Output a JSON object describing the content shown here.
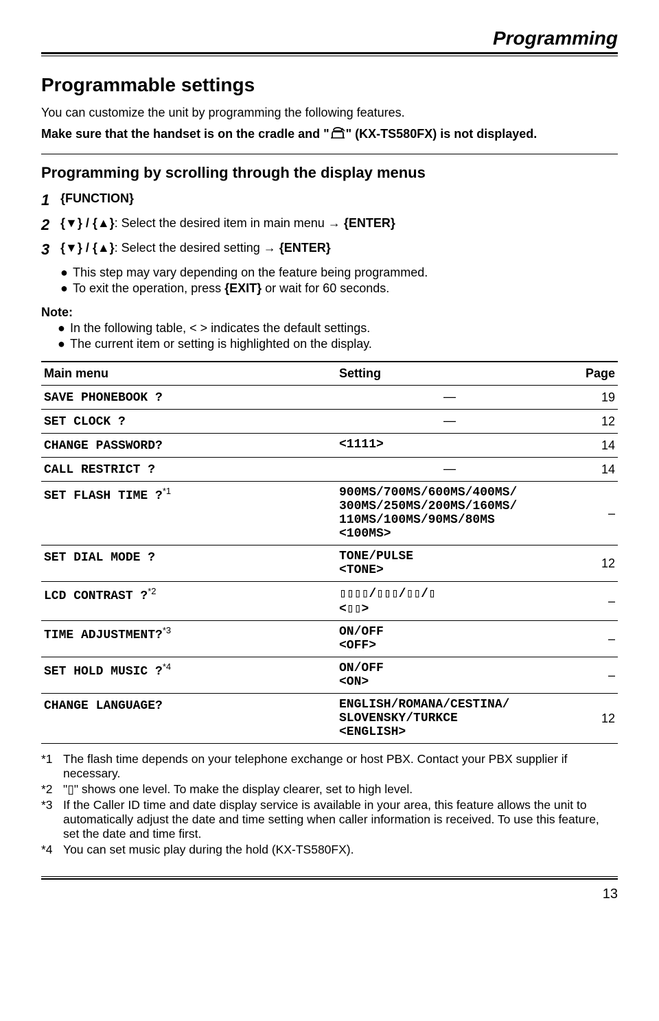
{
  "header": {
    "title": "Programming"
  },
  "h1": "Programmable settings",
  "intro": "You can customize the unit by programming the following features.",
  "intro_bold_a": "Make sure that the handset is on the cradle and \"",
  "intro_bold_b": "\" (KX-TS580FX) is not displayed.",
  "h2": "Programming by scrolling through the display menus",
  "steps": {
    "s1_key": "{FUNCTION}",
    "s2_a": "{▼} / {▲}",
    "s2_b": ": Select the desired item in main menu → ",
    "s2_c": "{ENTER}",
    "s3_a": "{▼} / {▲}",
    "s3_b": ": Select the desired setting → ",
    "s3_c": "{ENTER}"
  },
  "sub_bullets": {
    "b1": "This step may vary depending on the feature being programmed.",
    "b2_a": "To exit the operation, press ",
    "b2_key": "{EXIT}",
    "b2_b": " or wait for 60 seconds."
  },
  "note_label": "Note:",
  "note_bullets": {
    "n1": "In the following table, < > indicates the default settings.",
    "n2": "The current item or setting is highlighted on the display."
  },
  "table": {
    "head": {
      "c1": "Main menu",
      "c2": "Setting",
      "c3": "Page"
    },
    "rows": [
      {
        "menu": "SAVE PHONEBOOK ?",
        "sup": "",
        "setting": "—",
        "page": "19"
      },
      {
        "menu": "SET CLOCK ?",
        "sup": "",
        "setting": "—",
        "page": "12"
      },
      {
        "menu": "CHANGE PASSWORD?",
        "sup": "",
        "setting": "<1111>",
        "page": "14"
      },
      {
        "menu": "CALL RESTRICT ?",
        "sup": "",
        "setting": "—",
        "page": "14"
      },
      {
        "menu": "SET FLASH TIME ?",
        "sup": "*1",
        "setting": "900MS/700MS/600MS/400MS/\n300MS/250MS/200MS/160MS/\n110MS/100MS/90MS/80MS\n<100MS>",
        "page": "–"
      },
      {
        "menu": "SET DIAL MODE ?",
        "sup": "",
        "setting": "TONE/PULSE\n<TONE>",
        "page": "12"
      },
      {
        "menu": "LCD CONTRAST ?",
        "sup": "*2",
        "setting": "▯▯▯▯/▯▯▯/▯▯/▯\n<▯▯>",
        "page": "–"
      },
      {
        "menu": "TIME ADJUSTMENT?",
        "sup": "*3",
        "setting": "ON/OFF\n<OFF>",
        "page": "–"
      },
      {
        "menu": "SET HOLD MUSIC ?",
        "sup": "*4",
        "setting": "ON/OFF\n<ON>",
        "page": "–"
      },
      {
        "menu": "CHANGE LANGUAGE?",
        "sup": "",
        "setting": "ENGLISH/ROMANA/CESTINA/\nSLOVENSKY/TURKCE\n<ENGLISH>",
        "page": "12"
      }
    ]
  },
  "footnotes": {
    "f1_num": "*1",
    "f1": "The flash time depends on your telephone exchange or host PBX. Contact your PBX supplier if necessary.",
    "f2_num": "*2",
    "f2": "\"▯\" shows one level. To make the display clearer, set to high level.",
    "f3_num": "*3",
    "f3": "If the Caller ID time and date display service is available in your area, this feature allows the unit to automatically adjust the date and time setting when caller information is received. To use this feature, set the date and time first.",
    "f4_num": "*4",
    "f4": "You can set music play during the hold (KX-TS580FX)."
  },
  "page_number": "13"
}
